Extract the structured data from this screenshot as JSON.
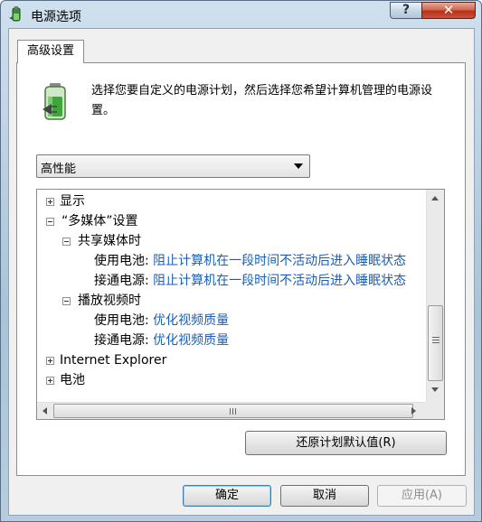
{
  "window": {
    "title": "电源选项"
  },
  "titlebar": {
    "help": "?",
    "close": "✕"
  },
  "tab": {
    "label": "高级设置"
  },
  "description": "选择您要自定义的电源计划，然后选择您希望计算机管理的电源设置。",
  "plan_select": {
    "value": "高性能"
  },
  "tree": {
    "display": "显示",
    "multimedia": "“多媒体”设置",
    "sharing": "共享媒体时",
    "sharing_battery_label": "使用电池:",
    "sharing_battery_value": "阻止计算机在一段时间不活动后进入睡眠状态",
    "sharing_plugged_label": "接通电源:",
    "sharing_plugged_value": "阻止计算机在一段时间不活动后进入睡眠状态",
    "video": "播放视频时",
    "video_battery_label": "使用电池:",
    "video_battery_value": "优化视频质量",
    "video_plugged_label": "接通电源:",
    "video_plugged_value": "优化视频质量",
    "ie": "Internet Explorer",
    "battery": "电池"
  },
  "buttons": {
    "restore": "还原计划默认值(R)",
    "ok": "确定",
    "cancel": "取消",
    "apply": "应用(A)"
  },
  "colors": {
    "link": "#1a5fb4",
    "close_button": "#c8513a"
  }
}
